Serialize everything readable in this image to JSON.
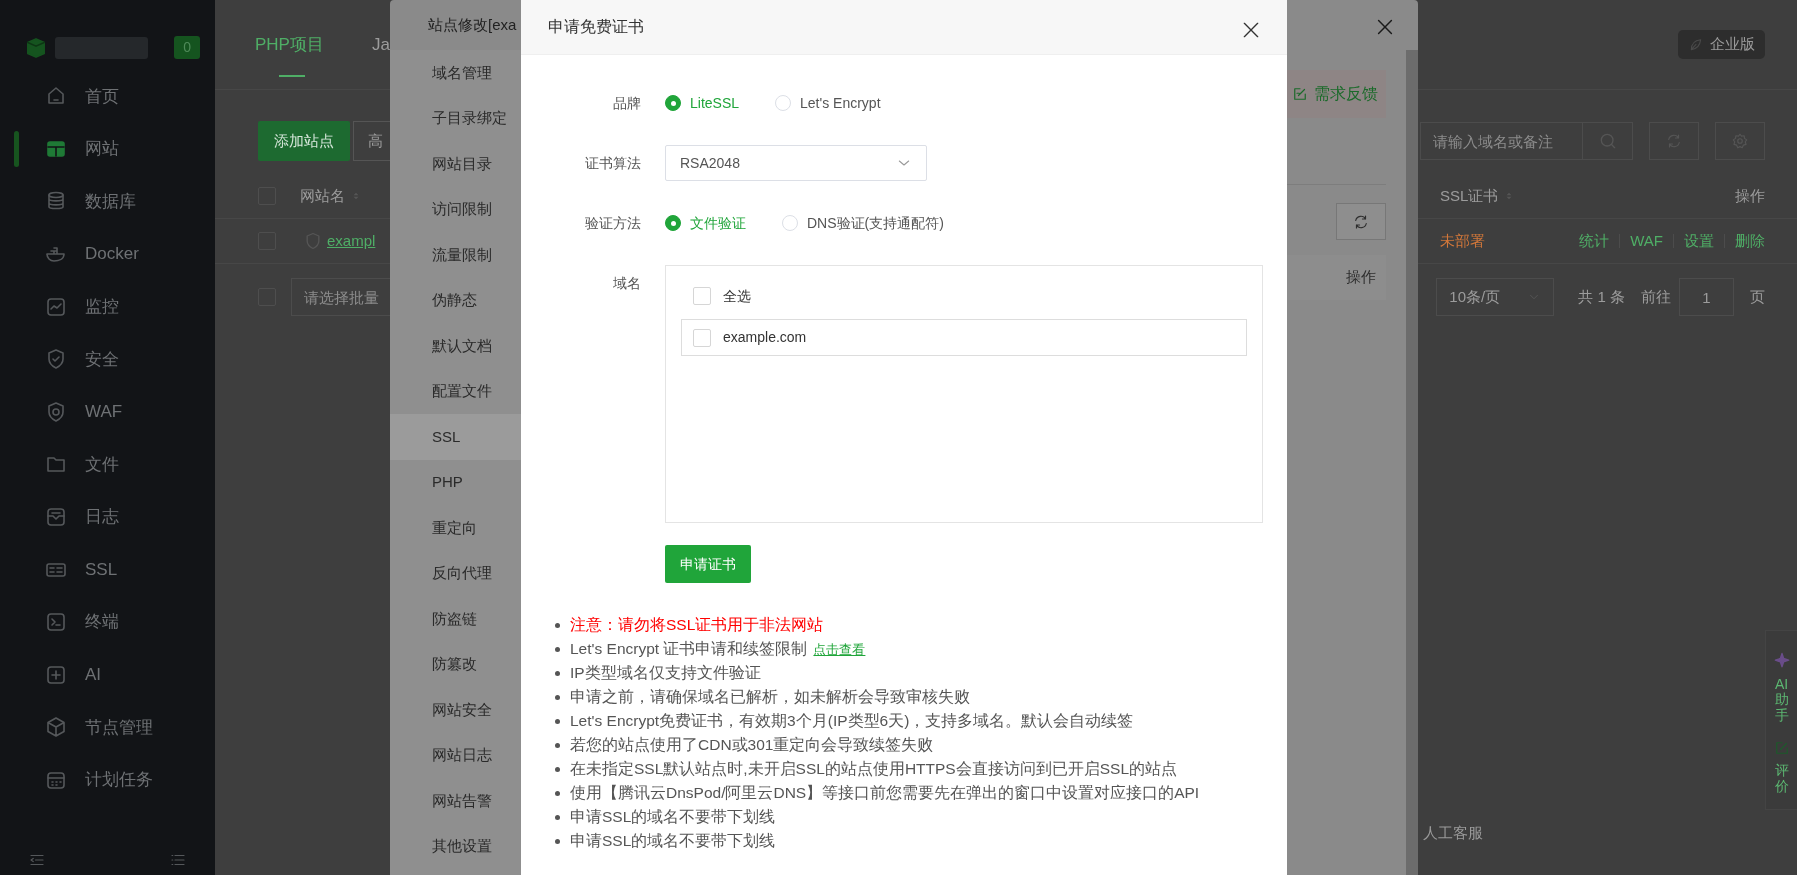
{
  "sidebar": {
    "badge": "0",
    "items": [
      {
        "label": "首页",
        "selected": false
      },
      {
        "label": "网站",
        "selected": true
      },
      {
        "label": "数据库",
        "selected": false
      },
      {
        "label": "Docker",
        "selected": false
      },
      {
        "label": "监控",
        "selected": false
      },
      {
        "label": "安全",
        "selected": false
      },
      {
        "label": "WAF",
        "selected": false
      },
      {
        "label": "文件",
        "selected": false
      },
      {
        "label": "日志",
        "selected": false
      },
      {
        "label": "SSL",
        "selected": false
      },
      {
        "label": "终端",
        "selected": false
      },
      {
        "label": "AI",
        "selected": false
      },
      {
        "label": "节点管理",
        "selected": false
      },
      {
        "label": "计划任务",
        "selected": false
      }
    ]
  },
  "main": {
    "tabs": [
      {
        "label": "PHP项目",
        "selected": true
      },
      {
        "label": "Ja",
        "selected": false
      }
    ],
    "edition_badge": "企业版",
    "add_button": "添加站点",
    "second_button": "高",
    "search": {
      "placeholder": "请输入域名或备注"
    },
    "table": {
      "header_checked": false,
      "columns": [
        "网站名",
        "SSL证书",
        "操作"
      ],
      "rows": [
        {
          "name": "exampl",
          "checked": false,
          "ssl_status": "未部署",
          "actions": [
            "统计",
            "WAF",
            "设置",
            "删除"
          ]
        }
      ]
    },
    "batch": {
      "checked": false,
      "placeholder": "请选择批量"
    },
    "pagination": {
      "page_size": "10条/页",
      "total": "共 1 条",
      "goto": "前往",
      "page": "1",
      "unit": "页"
    },
    "support_text": "人工客服",
    "float_widget": [
      "AI助手",
      "评价"
    ]
  },
  "site_modal": {
    "title": "站点修改[exa",
    "menu": [
      {
        "label": "域名管理",
        "selected": false
      },
      {
        "label": "子目录绑定",
        "selected": false
      },
      {
        "label": "网站目录",
        "selected": false
      },
      {
        "label": "访问限制",
        "selected": false
      },
      {
        "label": "流量限制",
        "selected": false
      },
      {
        "label": "伪静态",
        "selected": false
      },
      {
        "label": "默认文档",
        "selected": false
      },
      {
        "label": "配置文件",
        "selected": false
      },
      {
        "label": "SSL",
        "selected": true
      },
      {
        "label": "PHP",
        "selected": false
      },
      {
        "label": "重定向",
        "selected": false
      },
      {
        "label": "反向代理",
        "selected": false
      },
      {
        "label": "防盗链",
        "selected": false
      },
      {
        "label": "防篡改",
        "selected": false
      },
      {
        "label": "网站安全",
        "selected": false
      },
      {
        "label": "网站日志",
        "selected": false
      },
      {
        "label": "网站告警",
        "selected": false
      },
      {
        "label": "其他设置",
        "selected": false
      }
    ],
    "feedback_button": "需求反馈",
    "table_header": "操作"
  },
  "cert_modal": {
    "title": "申请免费证书",
    "fields": [
      {
        "kind": "radio",
        "label": "品牌",
        "options": [
          {
            "label": "LiteSSL",
            "selected": true
          },
          {
            "label": "Let's Encrypt",
            "selected": false
          }
        ]
      },
      {
        "kind": "select",
        "label": "证书算法",
        "value": "RSA2048"
      },
      {
        "kind": "radio",
        "label": "验证方法",
        "options": [
          {
            "label": "文件验证",
            "selected": true
          },
          {
            "label": "DNS验证(支持通配符)",
            "selected": false
          }
        ]
      },
      {
        "kind": "domains",
        "label": "域名",
        "select_all": {
          "label": "全选",
          "checked": false
        },
        "domains": [
          {
            "name": "example.com",
            "checked": false
          }
        ]
      }
    ],
    "submit": "申请证书",
    "notes": [
      {
        "kind": "warning",
        "text": "注意：请勿将SSL证书用于非法网站"
      },
      {
        "kind": "plain",
        "text": "Let's Encrypt 证书申请和续签限制",
        "link": "点击查看"
      },
      {
        "kind": "plain",
        "text": "IP类型域名仅支持文件验证"
      },
      {
        "kind": "plain",
        "text": "申请之前，请确保域名已解析，如未解析会导致审核失败"
      },
      {
        "kind": "plain",
        "text": "Let's Encrypt免费证书，有效期3个月(IP类型6天)，支持多域名。默认会自动续签"
      },
      {
        "kind": "plain",
        "text": "若您的站点使用了CDN或301重定向会导致续签失败"
      },
      {
        "kind": "plain",
        "text": "在未指定SSL默认站点时,未开启SSL的站点使用HTTPS会直接访问到已开启SSL的站点"
      },
      {
        "kind": "plain",
        "text": "使用【腾讯云DnsPod/阿里云DNS】等接口前您需要先在弹出的窗口中设置对应接口的API"
      },
      {
        "kind": "plain",
        "text": "申请SSL的域名不要带下划线"
      },
      {
        "kind": "plain",
        "text": "申请SSL的域名不要带下划线"
      }
    ]
  }
}
